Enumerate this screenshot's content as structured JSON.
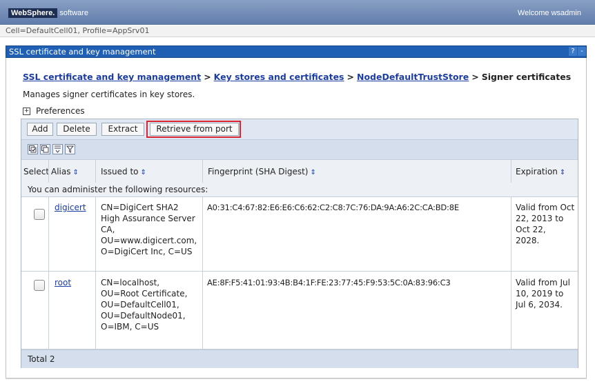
{
  "header": {
    "brand_name": "WebSphere.",
    "brand_suffix": "software",
    "welcome": "Welcome wsadmin"
  },
  "context_bar": "Cell=DefaultCell01, Profile=AppSrv01",
  "portlet": {
    "title": "SSL certificate and key management",
    "help_icon": "?",
    "minimize_icon": "-"
  },
  "breadcrumb": {
    "items": [
      "SSL certificate and key management",
      "Key stores and certificates",
      "NodeDefaultTrustStore"
    ],
    "separator": ">",
    "current": "Signer certificates"
  },
  "description": "Manages signer certificates in key stores.",
  "preferences": {
    "expander": "+",
    "label": "Preferences"
  },
  "toolbar": {
    "add": "Add",
    "delete": "Delete",
    "extract": "Extract",
    "retrieve": "Retrieve from port",
    "highlight_color": "#d9232f"
  },
  "icon_toolbar": [
    "select-all-icon",
    "deselect-all-icon",
    "show-filter-icon",
    "clear-filter-icon"
  ],
  "table": {
    "columns": {
      "select": "Select",
      "alias": "Alias",
      "issued_to": "Issued to",
      "fingerprint": "Fingerprint (SHA Digest)",
      "expiration": "Expiration"
    },
    "sort_glyph": "⇕",
    "admin_note": "You can administer the following resources:",
    "rows": [
      {
        "alias": "digicert",
        "issued_to": [
          "CN=DigiCert SHA2",
          "High Assurance Server",
          "CA,",
          "OU=www.digicert.com,",
          "O=DigiCert Inc, C=US"
        ],
        "fingerprint": "A0:31:C4:67:82:E6:E6:C6:62:C2:C8:7C:76:DA:9A:A6:2C:CA:BD:8E",
        "expiration": [
          "Valid from Oct",
          "22, 2013 to",
          "Oct 22,",
          "2028."
        ]
      },
      {
        "alias": "root",
        "issued_to": [
          "CN=localhost,",
          "OU=Root Certificate,",
          "OU=DefaultCell01,",
          "OU=DefaultNode01,",
          "O=IBM, C=US"
        ],
        "fingerprint": "AE:8F:F5:41:01:93:4B:B4:1F:FE:23:77:45:F9:53:5C:0A:83:96:C3",
        "expiration": [
          "Valid from Jul",
          "10, 2019 to",
          "Jul 6, 2034."
        ]
      }
    ],
    "total": "Total 2"
  },
  "colors": {
    "portlet_title": "#1f5fb4",
    "link": "#1b3ca3",
    "toolbar_bg": "#dfe7f3",
    "banner": "#5f7cab"
  }
}
